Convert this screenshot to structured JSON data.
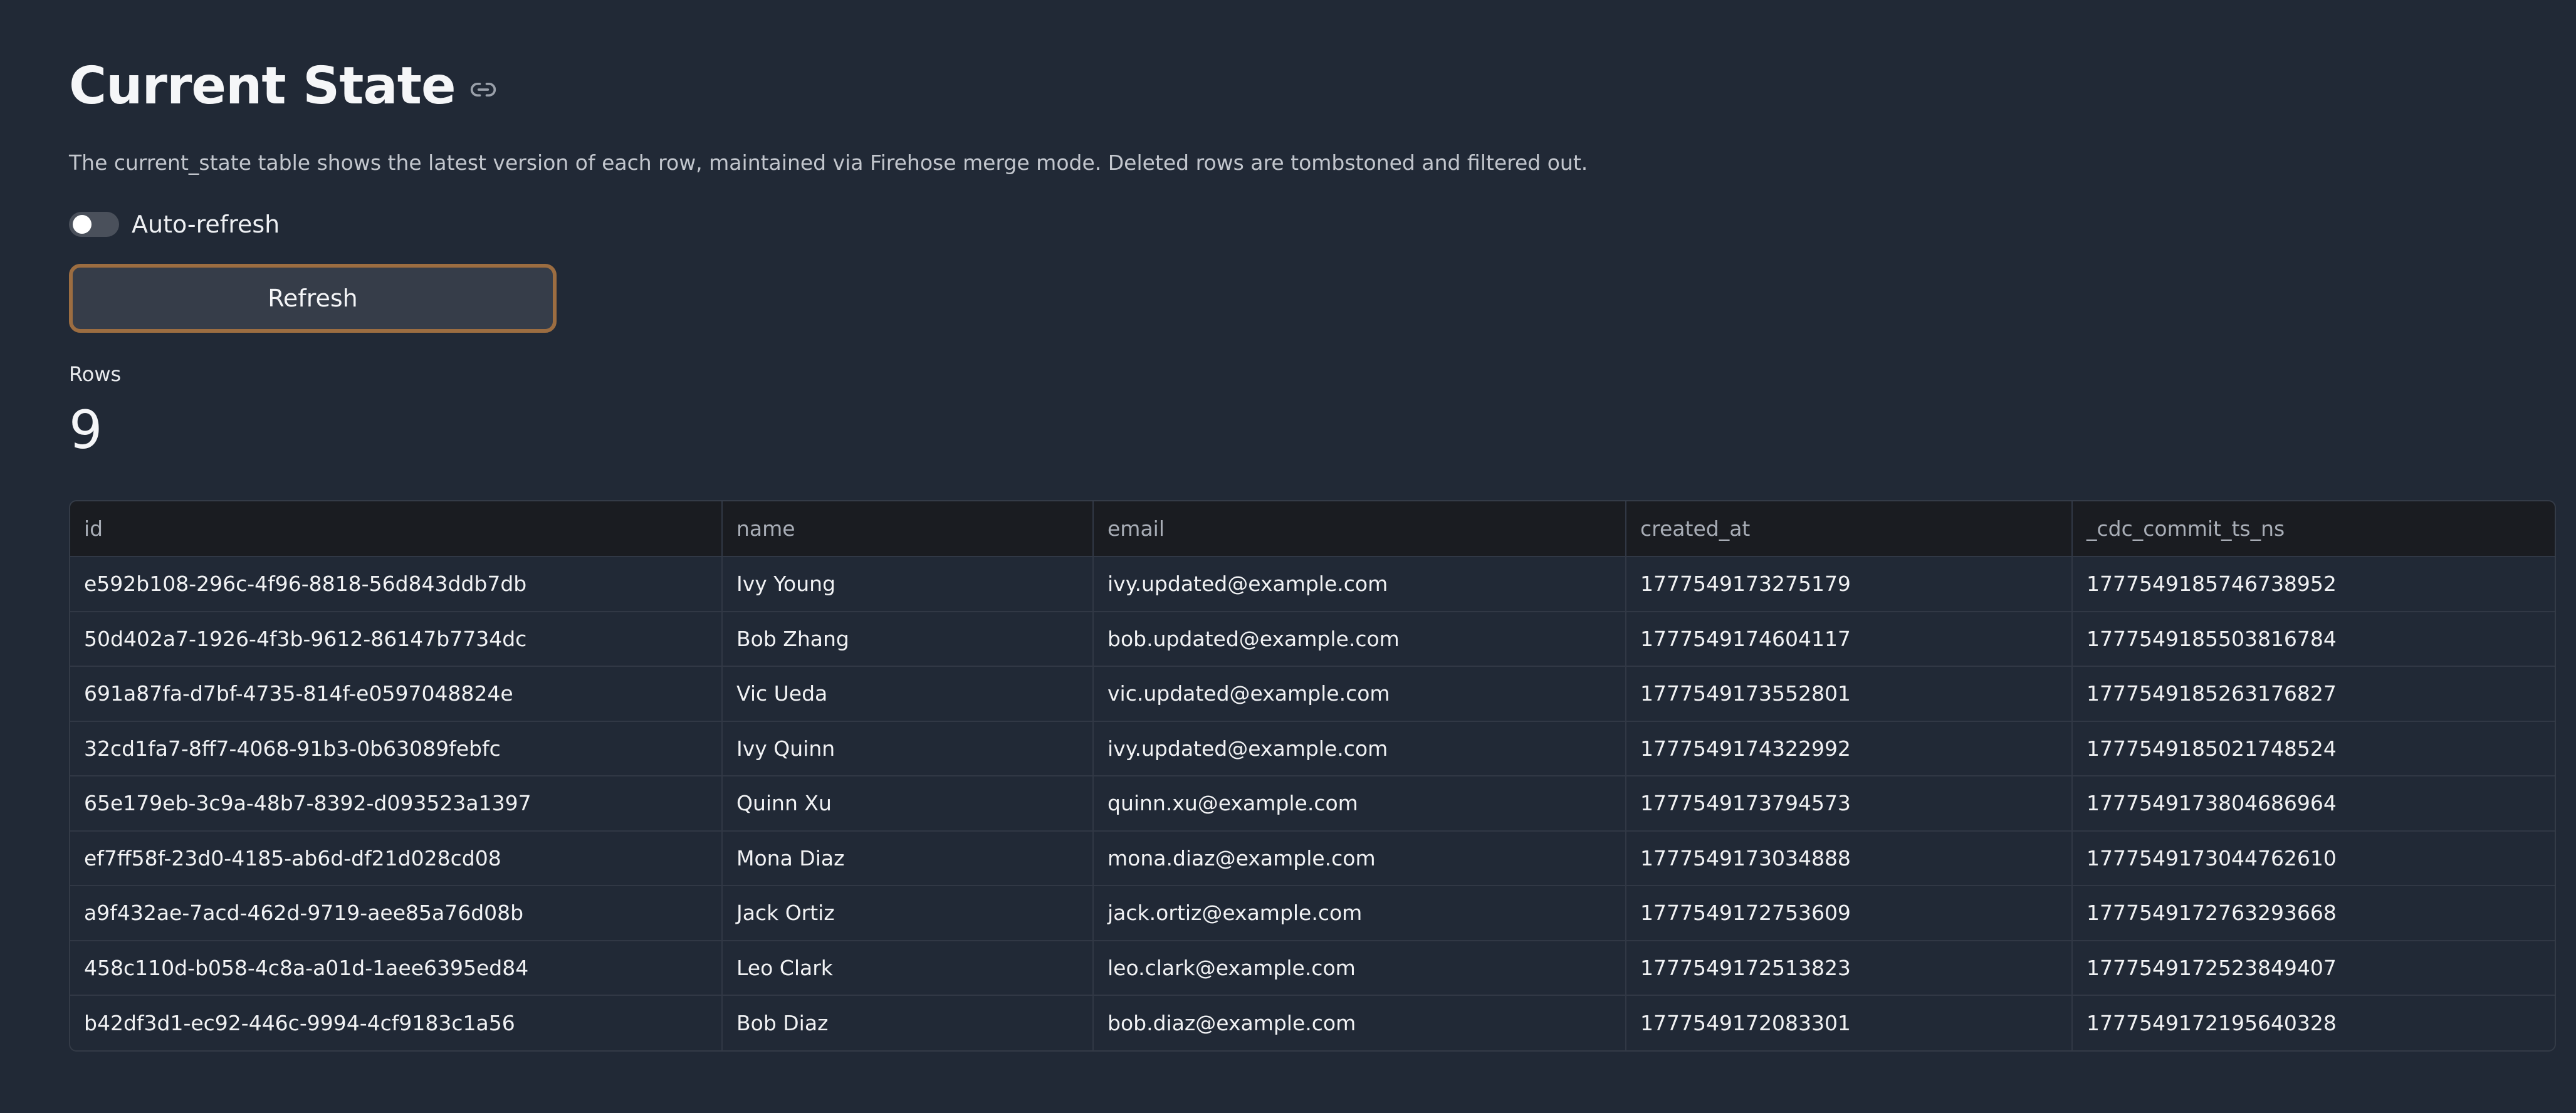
{
  "header": {
    "title": "Current State",
    "description": "The current_state table shows the latest version of each row, maintained via Firehose merge mode. Deleted rows are tombstoned and filtered out."
  },
  "controls": {
    "auto_refresh_label": "Auto-refresh",
    "auto_refresh_on": false,
    "refresh_label": "Refresh"
  },
  "metric": {
    "label": "Rows",
    "value": "9"
  },
  "table": {
    "columns": [
      "id",
      "name",
      "email",
      "created_at",
      "_cdc_commit_ts_ns"
    ],
    "rows": [
      [
        "e592b108-296c-4f96-8818-56d843ddb7db",
        "Ivy Young",
        "ivy.updated@example.com",
        "1777549173275179",
        "1777549185746738952"
      ],
      [
        "50d402a7-1926-4f3b-9612-86147b7734dc",
        "Bob Zhang",
        "bob.updated@example.com",
        "1777549174604117",
        "1777549185503816784"
      ],
      [
        "691a87fa-d7bf-4735-814f-e0597048824e",
        "Vic Ueda",
        "vic.updated@example.com",
        "1777549173552801",
        "1777549185263176827"
      ],
      [
        "32cd1fa7-8ff7-4068-91b3-0b63089febfc",
        "Ivy Quinn",
        "ivy.updated@example.com",
        "1777549174322992",
        "1777549185021748524"
      ],
      [
        "65e179eb-3c9a-48b7-8392-d093523a1397",
        "Quinn Xu",
        "quinn.xu@example.com",
        "1777549173794573",
        "1777549173804686964"
      ],
      [
        "ef7ff58f-23d0-4185-ab6d-df21d028cd08",
        "Mona Diaz",
        "mona.diaz@example.com",
        "1777549173034888",
        "1777549173044762610"
      ],
      [
        "a9f432ae-7acd-462d-9719-aee85a76d08b",
        "Jack Ortiz",
        "jack.ortiz@example.com",
        "1777549172753609",
        "1777549172763293668"
      ],
      [
        "458c110d-b058-4c8a-a01d-1aee6395ed84",
        "Leo Clark",
        "leo.clark@example.com",
        "1777549172513823",
        "1777549172523849407"
      ],
      [
        "b42df3d1-ec92-446c-9994-4cf9183c1a56",
        "Bob Diaz",
        "bob.diaz@example.com",
        "1777549172083301",
        "1777549172195640328"
      ]
    ]
  },
  "icons": {
    "title_link": "link-icon"
  }
}
